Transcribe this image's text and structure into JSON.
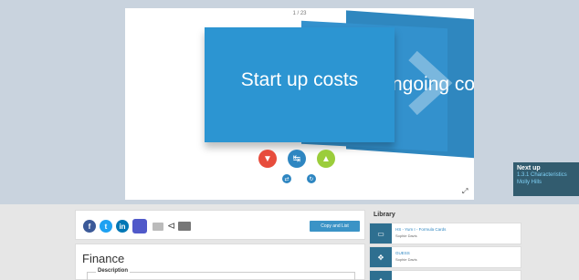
{
  "viewer": {
    "counter": "1 / 23",
    "card_front_text": "Start up costs",
    "card_back_text": "ngoing co"
  },
  "next_up": {
    "title": "Next up",
    "link": "1.3.1 Characteristics",
    "author": "Molly Hills"
  },
  "share": {
    "facebook": "f",
    "twitter": "t",
    "linkedin": "in",
    "copy_button": "Copy and List"
  },
  "finance": {
    "title": "Finance",
    "description_label": "Description"
  },
  "library": {
    "title": "Library",
    "items": [
      {
        "name": "HS - Yum I - Formula Cards",
        "author": "Sophie Davis"
      },
      {
        "name": "GUESS",
        "author": "Sophie Davis"
      },
      {
        "name": "",
        "author": ""
      }
    ]
  },
  "colors": {
    "card_blue": "#2c95d2",
    "band": "#c9d3de",
    "next_up_bg": "#325c6f"
  }
}
